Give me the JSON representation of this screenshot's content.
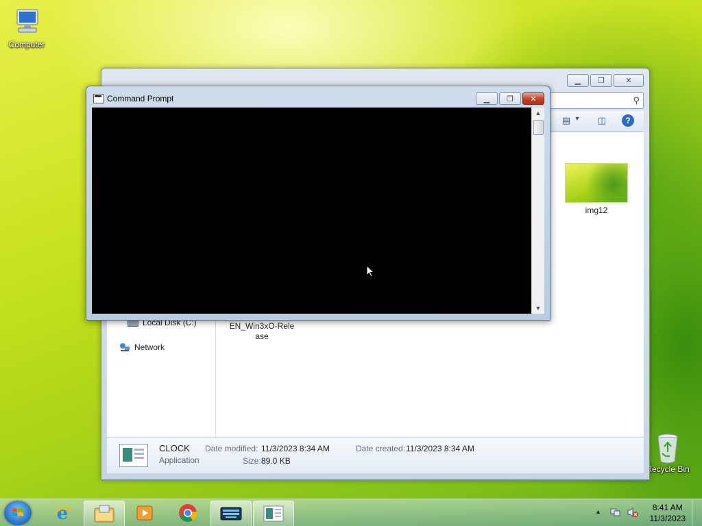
{
  "desktop": {
    "icons": [
      {
        "label": "Computer"
      },
      {
        "label": "Recycle Bin"
      }
    ]
  },
  "explorer": {
    "nav": {
      "local_disk": "Local Disk (C:)",
      "network": "Network"
    },
    "files": [
      {
        "name": "img12"
      },
      {
        "name_line1": "EN_Win3xO-Rele",
        "name_line2": "ase"
      }
    ],
    "details": {
      "name": "CLOCK",
      "type": "Application",
      "modified_label": "Date modified:",
      "modified_value": "11/3/2023 8:34 AM",
      "created_label": "Date created:",
      "created_value": "11/3/2023 8:34 AM",
      "size_label": "Size:",
      "size_value": "89.0 KB"
    }
  },
  "cmd": {
    "title": "Command Prompt"
  },
  "taskbar": {
    "clock_time": "8:41 AM",
    "clock_date": "11/3/2023"
  },
  "colors": {
    "console_bg": "#000000",
    "close_red": "#c7432a",
    "accent_blue": "#2a6cc4"
  }
}
